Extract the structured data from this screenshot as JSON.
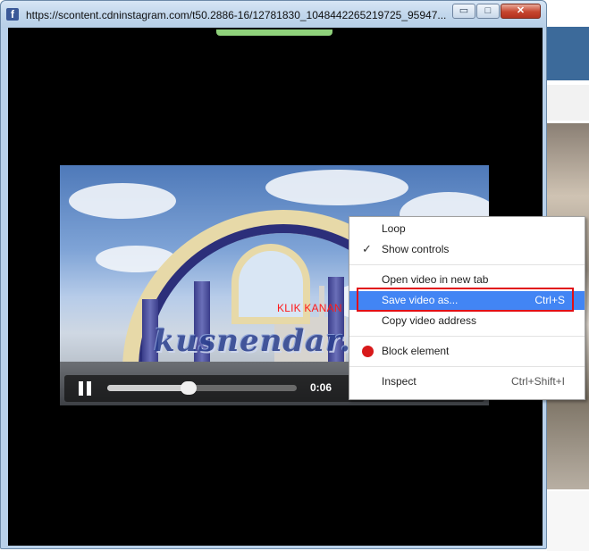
{
  "window": {
    "url": "https://scontent.cdninstagram.com/t50.2886-16/12781830_1048442265219725_95947...",
    "favicon": "f",
    "minimize_glyph": "▭",
    "maximize_glyph": "□",
    "close_glyph": "✕"
  },
  "video": {
    "progress_fraction": 0.43,
    "time": "0:06",
    "overlay_text": "KLIK KANAN",
    "watermark": "kusnendar.web.id"
  },
  "context_menu": {
    "items": [
      {
        "label": "Loop",
        "shortcut": "",
        "checked": false
      },
      {
        "label": "Show controls",
        "shortcut": "",
        "checked": true
      },
      {
        "label": "Open video in new tab",
        "shortcut": ""
      },
      {
        "label": "Save video as...",
        "shortcut": "Ctrl+S",
        "highlighted": true
      },
      {
        "label": "Copy video address",
        "shortcut": ""
      },
      {
        "label": "Block element",
        "shortcut": ""
      },
      {
        "label": "Inspect",
        "shortcut": "Ctrl+Shift+I"
      }
    ],
    "check_glyph": "✓"
  },
  "colors": {
    "highlight": "#4285f4",
    "annotation_red": "#e10f16",
    "loading_bar": "#8fd17b"
  }
}
